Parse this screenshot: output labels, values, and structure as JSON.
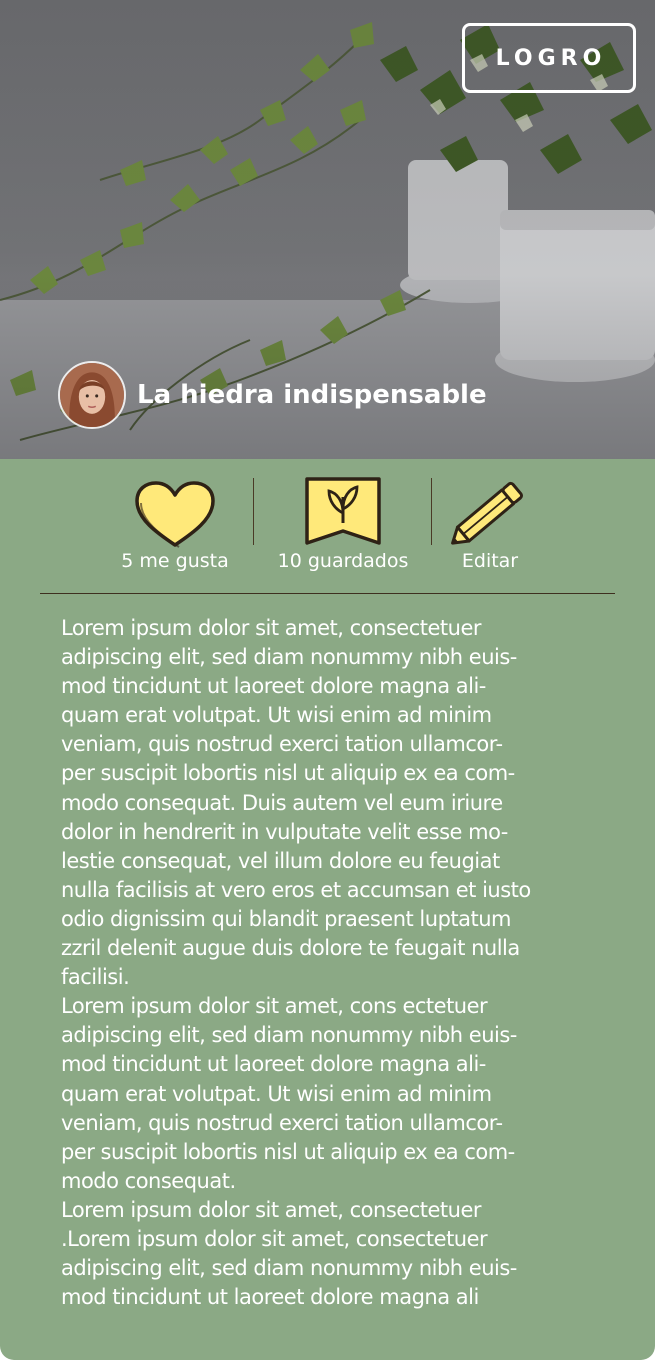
{
  "card": {
    "badge_label": "LOGRO",
    "title": "La hiedra indispensable"
  },
  "actions": {
    "like_label": "5 me gusta",
    "save_label": "10 guardados",
    "edit_label": "Editar"
  },
  "body": {
    "paragraphs": [
      "Lorem ipsum dolor sit amet, consectetuer\nadipiscing elit, sed diam nonummy nibh euis-\nmod tincidunt ut laoreet dolore magna ali-\nquam erat volutpat. Ut wisi enim ad minim\nveniam, quis nostrud exerci tation ullamcor-\nper suscipit lobortis nisl ut aliquip ex ea com-\nmodo consequat. Duis autem vel eum iriure\ndolor in hendrerit in vulputate velit esse mo-\nlestie consequat, vel illum dolore eu feugiat\nnulla facilisis at vero eros et accumsan et iusto\nodio dignissim qui blandit praesent luptatum\nzzril delenit augue duis dolore te feugait nulla\nfacilisi.",
      "Lorem ipsum dolor sit amet, cons ectetuer\nadipiscing elit, sed diam nonummy nibh euis-\nmod tincidunt ut laoreet dolore magna ali-\nquam erat volutpat. Ut wisi enim ad minim\nveniam, quis nostrud exerci tation ullamcor-\nper suscipit lobortis nisl ut aliquip ex ea com-\nmodo consequat.",
      "Lorem ipsum dolor sit amet, consectetuer\n.Lorem ipsum dolor sit amet, consectetuer\nadipiscing elit, sed diam nonummy nibh euis-\nmod tincidunt ut laoreet dolore magna ali"
    ]
  },
  "colors": {
    "card_background": "#8ba985",
    "icon_fill": "#ffe97a",
    "icon_outline": "#2e2216",
    "divider": "#3e2f1f"
  },
  "icons": {
    "like": "heart-icon",
    "save": "leaf-bookmark-icon",
    "edit": "pencil-icon"
  }
}
